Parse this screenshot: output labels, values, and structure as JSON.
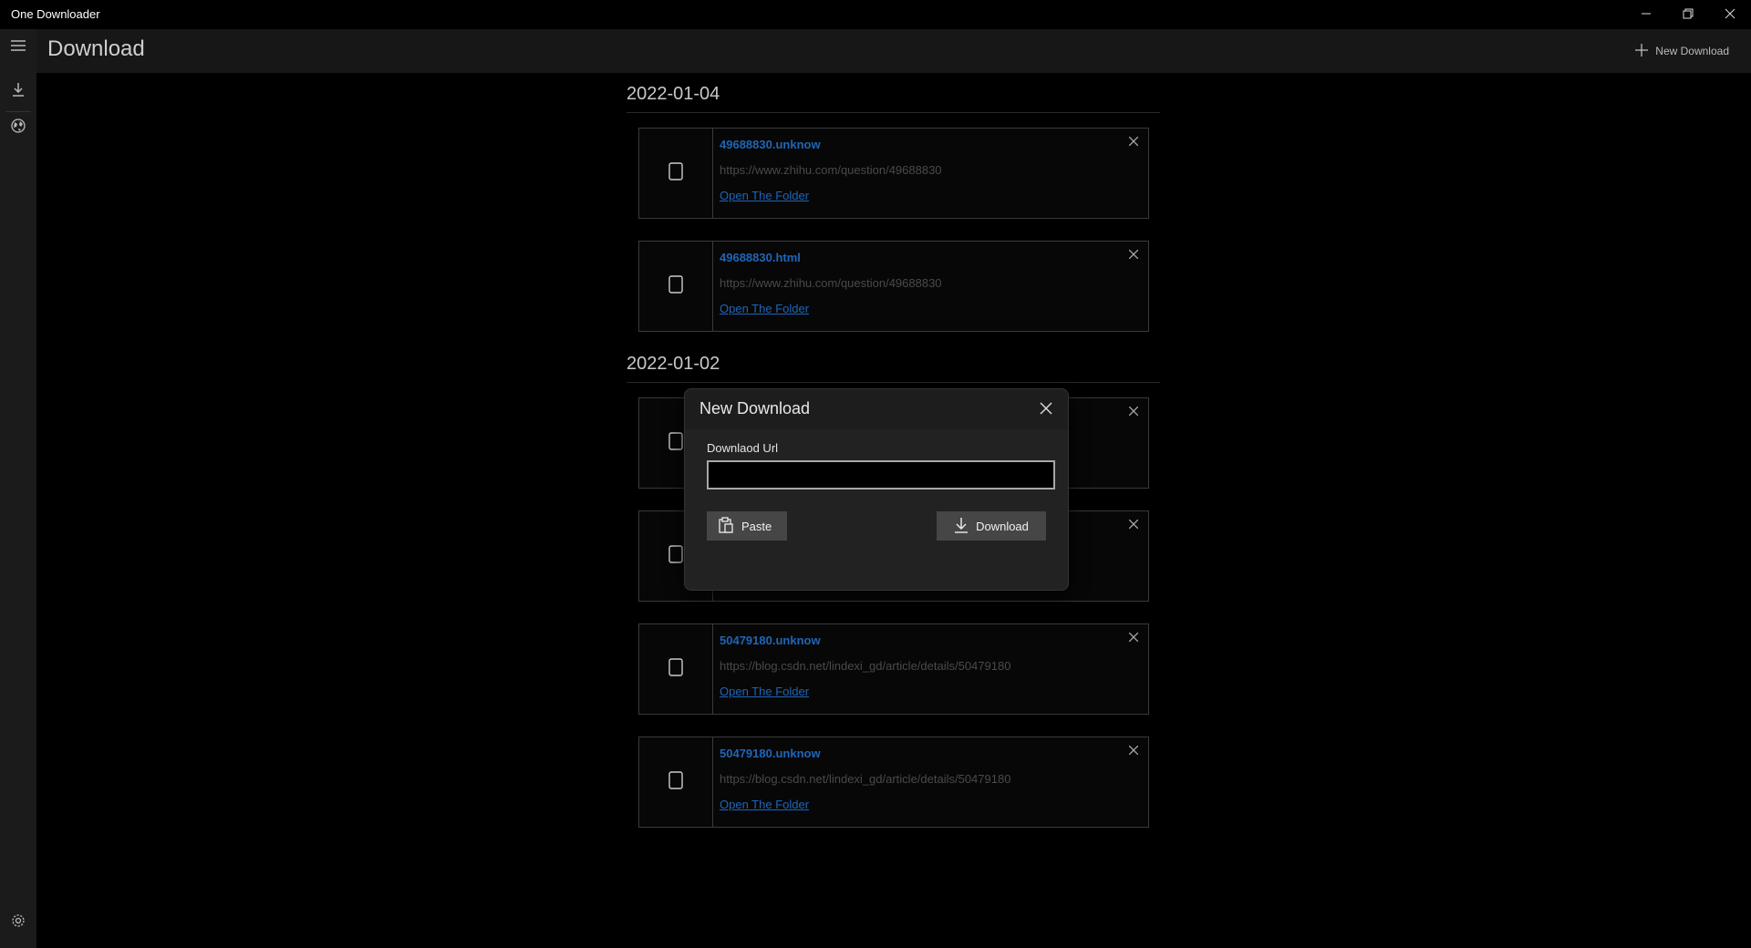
{
  "app": {
    "title": "One Downloader"
  },
  "window_controls": {
    "minimize": "—",
    "maximize": "❐",
    "close": "✕"
  },
  "header": {
    "title": "Download",
    "new_download_label": "New Download"
  },
  "sidebar": {
    "items": [
      "menu-icon",
      "download-icon",
      "globe-icon"
    ],
    "settings_icon": "gear-icon"
  },
  "groups": [
    {
      "date": "2022-01-04",
      "items": [
        {
          "name": "49688830.unknow",
          "url": "https://www.zhihu.com/question/49688830",
          "link": "Open The Folder"
        },
        {
          "name": "49688830.html",
          "url": "https://www.zhihu.com/question/49688830",
          "link": "Open The Folder"
        }
      ]
    },
    {
      "date": "2022-01-02",
      "items": [
        {
          "name": "",
          "url": "",
          "link": ""
        },
        {
          "name": "",
          "url": "",
          "link": ""
        },
        {
          "name": "50479180.unknow",
          "url": "https://blog.csdn.net/lindexi_gd/article/details/50479180",
          "link": "Open The Folder"
        },
        {
          "name": "50479180.unknow",
          "url": "https://blog.csdn.net/lindexi_gd/article/details/50479180",
          "link": "Open The Folder"
        }
      ]
    }
  ],
  "dialog": {
    "title": "New Download",
    "field_label": "Downlaod Url",
    "input_value": "",
    "paste_label": "Paste",
    "download_label": "Download"
  },
  "colors": {
    "accent_link": "#1f66b8",
    "background": "#000000",
    "panel": "#222222"
  }
}
